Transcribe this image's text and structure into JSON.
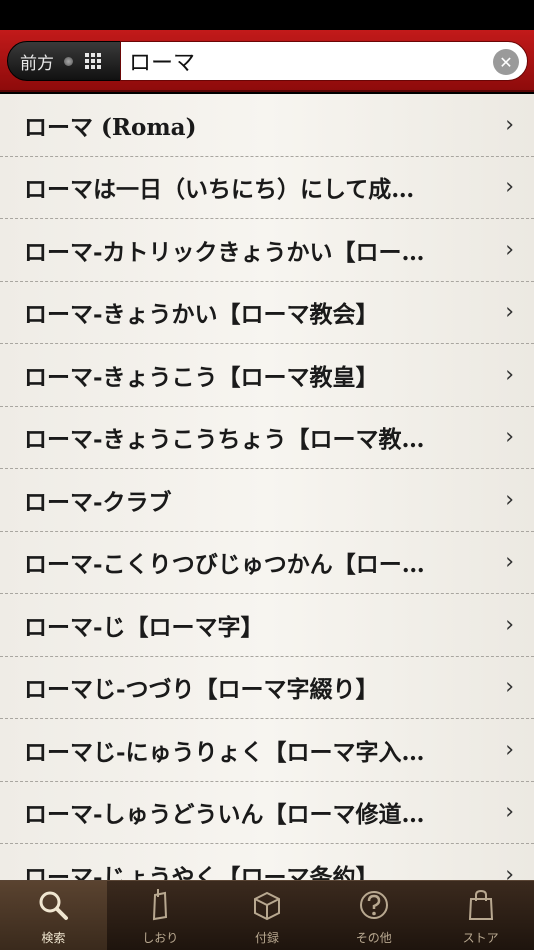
{
  "search": {
    "mode_label": "前方",
    "query": "ローマ",
    "clear_symbol": "✕"
  },
  "results": [
    {
      "text": "ローマ (Roma)"
    },
    {
      "text": "ローマは一日（いちにち）にして成…"
    },
    {
      "text": "ローマ-カトリックきょうかい【ロー…"
    },
    {
      "text": "ローマ-きょうかい【ローマ教会】"
    },
    {
      "text": "ローマ-きょうこう【ローマ教皇】"
    },
    {
      "text": "ローマ-きょうこうちょう【ローマ教…"
    },
    {
      "text": "ローマ-クラブ"
    },
    {
      "text": "ローマ-こくりつびじゅつかん【ロー…"
    },
    {
      "text": "ローマ-じ【ローマ字】"
    },
    {
      "text": "ローマじ-つづり【ローマ字綴り】"
    },
    {
      "text": "ローマじ-にゅうりょく【ローマ字入…"
    },
    {
      "text": "ローマ-しゅうどういん【ローマ修道…"
    },
    {
      "text": "ローマ-じょうやく【ローマ条約】"
    }
  ],
  "row_chevron": "›",
  "tabs": [
    {
      "label": "検索",
      "icon": "search-icon",
      "active": true
    },
    {
      "label": "しおり",
      "icon": "bookmark-icon",
      "active": false
    },
    {
      "label": "付録",
      "icon": "box-icon",
      "active": false
    },
    {
      "label": "その他",
      "icon": "question-icon",
      "active": false
    },
    {
      "label": "ストア",
      "icon": "shopping-bag-icon",
      "active": false
    }
  ]
}
